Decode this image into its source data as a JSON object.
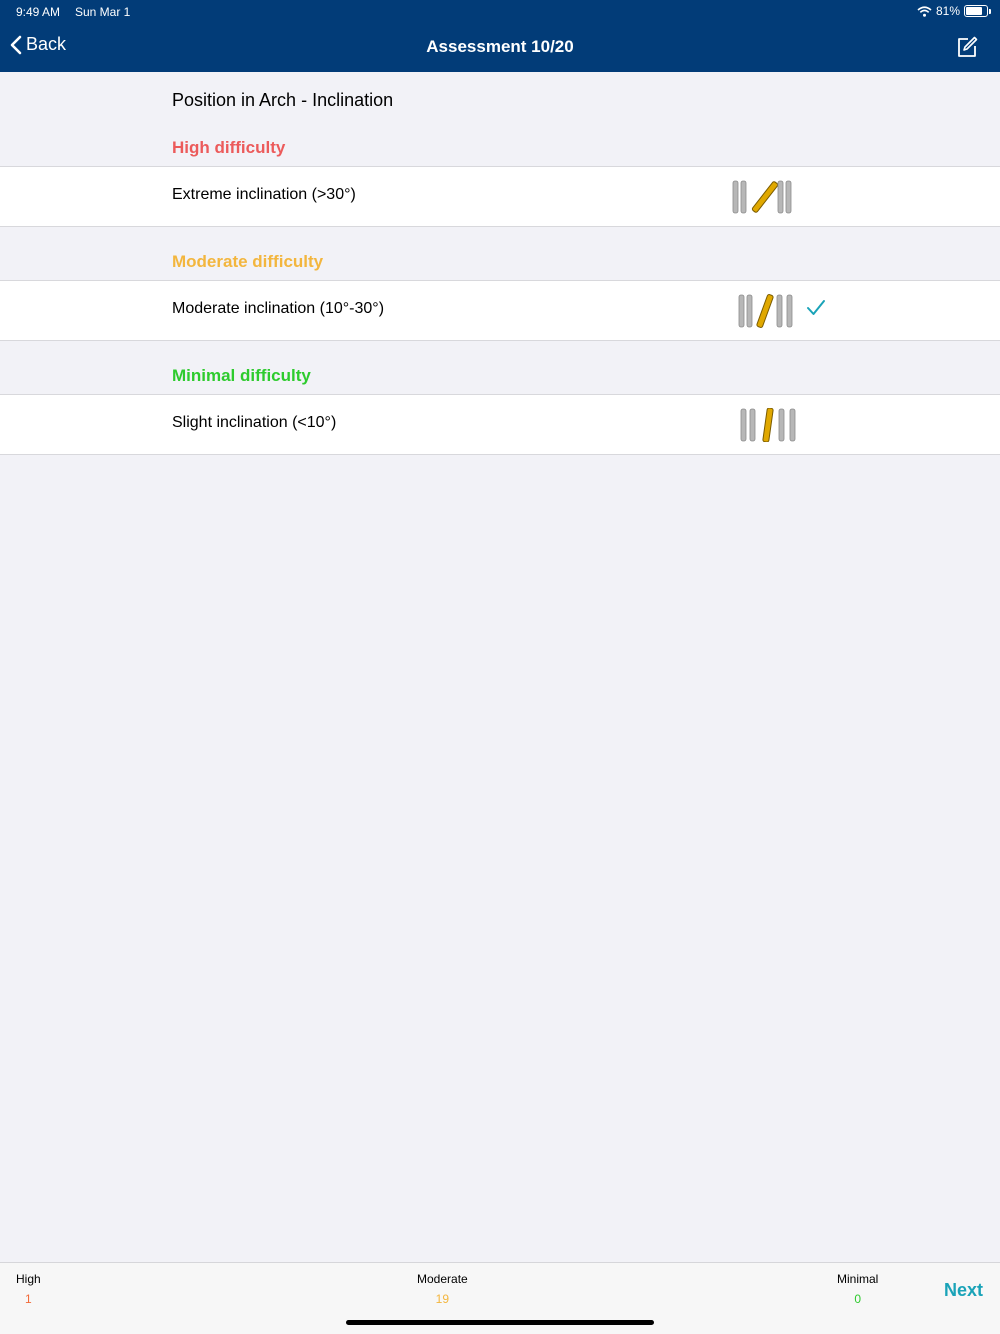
{
  "status_bar": {
    "time": "9:49 AM",
    "date": "Sun Mar 1",
    "battery": "81%"
  },
  "nav": {
    "back_label": "Back",
    "title": "Assessment 10/20",
    "edit_icon": "compose-icon"
  },
  "section_title": "Position in Arch - Inclination",
  "groups": [
    {
      "header": "High difficulty",
      "color": "#ec5b5b",
      "option": "Extreme inclination (>30°)",
      "selected": false
    },
    {
      "header": "Moderate difficulty",
      "color": "#f3b63e",
      "option": "Moderate inclination (10°-30°)",
      "selected": true
    },
    {
      "header": "Minimal difficulty",
      "color": "#2ecb2e",
      "option": "Slight inclination (<10°)",
      "selected": false
    }
  ],
  "footer": {
    "high": {
      "label": "High",
      "value": "1",
      "color": "#f26b3a"
    },
    "moderate": {
      "label": "Moderate",
      "value": "19",
      "color": "#f3b63e"
    },
    "minimal": {
      "label": "Minimal",
      "value": "0",
      "color": "#2ecb2e"
    },
    "next_label": "Next"
  },
  "colors": {
    "accent": "#1aa3b8",
    "nav_bg": "#023c78"
  }
}
